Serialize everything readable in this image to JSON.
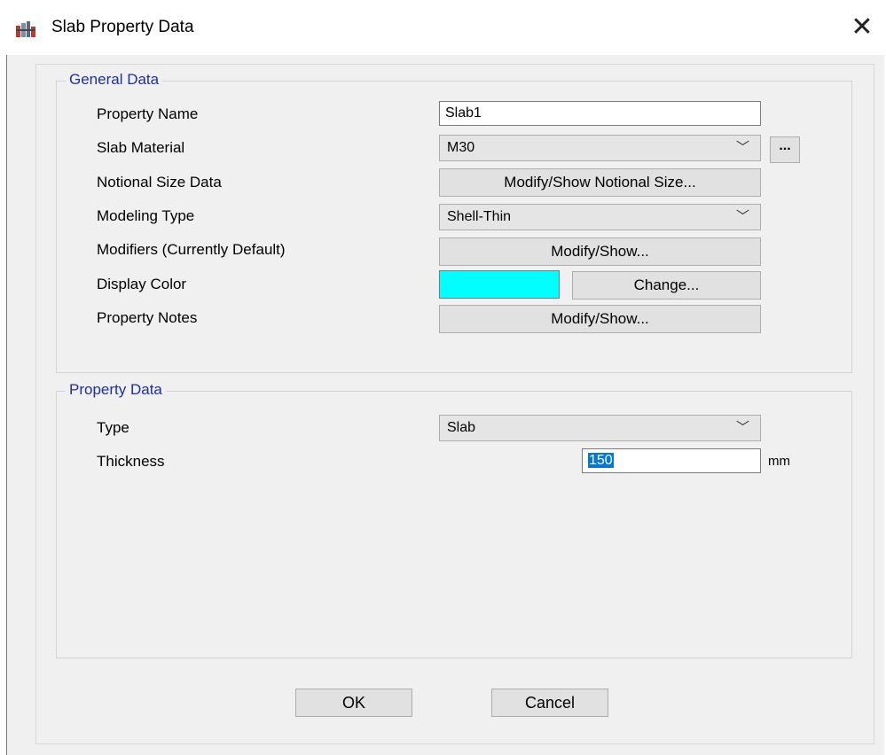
{
  "window": {
    "title": "Slab Property Data",
    "close_symbol": "✕",
    "icon": "slab-app-icon"
  },
  "general": {
    "legend": "General Data",
    "property_name_label": "Property Name",
    "property_name_value": "Slab1",
    "slab_material_label": "Slab Material",
    "slab_material_value": "M30",
    "material_more_button": "...",
    "notional_label": "Notional Size Data",
    "notional_button": "Modify/Show Notional Size...",
    "modeling_type_label": "Modeling Type",
    "modeling_type_value": "Shell-Thin",
    "modifiers_label": "Modifiers (Currently Default)",
    "modifiers_button": "Modify/Show...",
    "display_color_label": "Display Color",
    "display_color": "#00ffff",
    "change_button": "Change...",
    "notes_label": "Property Notes",
    "notes_button": "Modify/Show..."
  },
  "property": {
    "legend": "Property Data",
    "type_label": "Type",
    "type_value": "Slab",
    "thickness_label": "Thickness",
    "thickness_value": "150",
    "thickness_unit": "mm"
  },
  "footer": {
    "ok_label": "OK",
    "cancel_label": "Cancel"
  }
}
